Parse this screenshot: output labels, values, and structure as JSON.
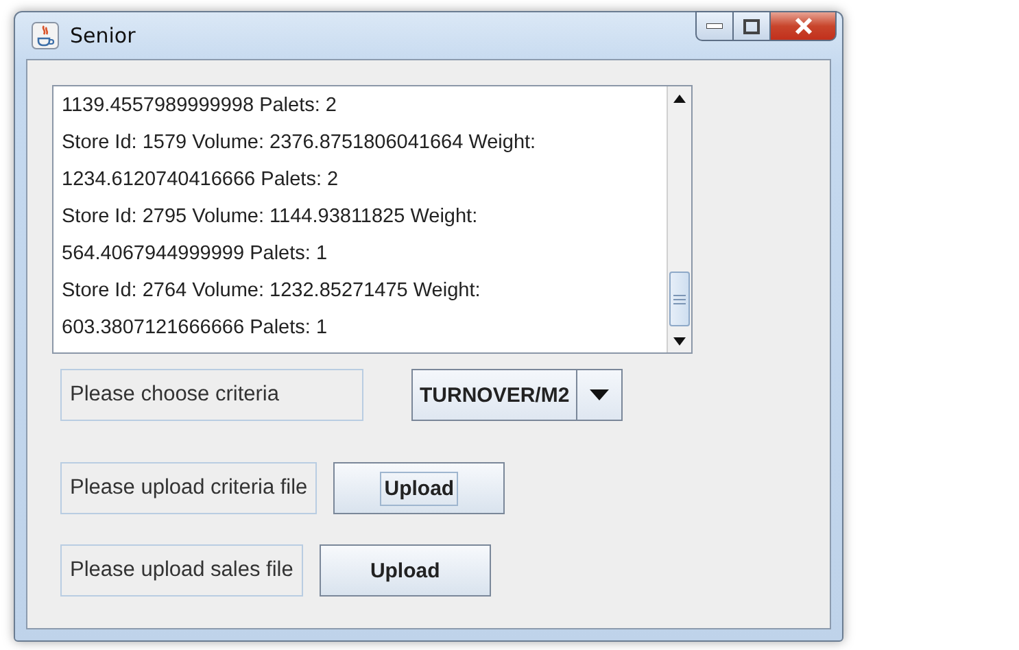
{
  "window": {
    "title": "Senior"
  },
  "output": {
    "lines": [
      "1139.4557989999998 Palets: 2",
      "Store Id: 1579 Volume: 2376.8751806041664 Weight:",
      "1234.6120740416666 Palets: 2",
      "Store Id: 2795 Volume: 1144.93811825 Weight:",
      "564.4067944999999 Palets: 1",
      "Store Id: 2764 Volume: 1232.85271475 Weight:",
      "603.3807121666666 Palets: 1"
    ]
  },
  "criteria": {
    "label": "Please choose criteria",
    "value": "TURNOVER/M2"
  },
  "uploads": [
    {
      "label": "Please upload criteria file",
      "button": "Upload",
      "focused": true
    },
    {
      "label": "Please upload sales file",
      "button": "Upload",
      "focused": false
    }
  ]
}
